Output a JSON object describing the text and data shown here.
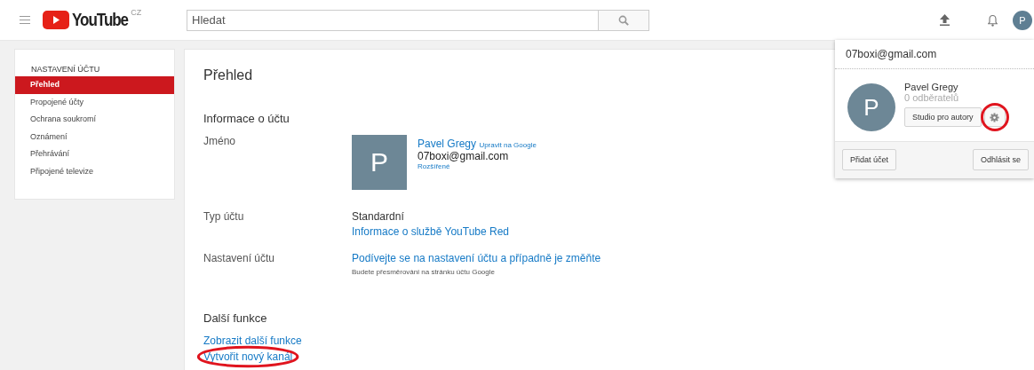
{
  "header": {
    "logo_text": "YouTube",
    "logo_region": "CZ",
    "search": {
      "placeholder": "Hledat"
    },
    "avatar_letter": "P"
  },
  "sidebar": {
    "heading": "NASTAVENÍ ÚČTU",
    "items": [
      {
        "label": "Přehled",
        "selected": true
      },
      {
        "label": "Propojené účty",
        "selected": false
      },
      {
        "label": "Ochrana soukromí",
        "selected": false
      },
      {
        "label": "Oznámení",
        "selected": false
      },
      {
        "label": "Přehrávání",
        "selected": false
      },
      {
        "label": "Připojené televize",
        "selected": false
      }
    ]
  },
  "main": {
    "title": "Přehled",
    "section": "Informace o účtu",
    "name_row": {
      "label": "Jméno",
      "avatar_letter": "P",
      "name": "Pavel Gregy",
      "edit_link": "Upravit na Google",
      "email": "07boxi@gmail.com",
      "advanced_link": "Rozšířené"
    },
    "type_row": {
      "label": "Typ účtu",
      "value": "Standardní",
      "link": "Informace o službě YouTube Red"
    },
    "settings_row": {
      "label": "Nastavení účtu",
      "link": "Podívejte se na nastavení účtu a případně je změňte",
      "note": "Budete přesměrováni na stránku účtu Google"
    },
    "more_section": "Další funkce",
    "more_links": [
      {
        "label": "Zobrazit další funkce",
        "highlighted": false
      },
      {
        "label": "Vytvořit nový kanál",
        "highlighted": true
      }
    ]
  },
  "account_menu": {
    "email": "07boxi@gmail.com",
    "avatar_letter": "P",
    "name": "Pavel Gregy",
    "subscribers": "0 odběratelů",
    "studio_button": "Studio pro autory",
    "settings_highlighted": true,
    "add_account": "Přidat účet",
    "sign_out": "Odhlásit se"
  }
}
